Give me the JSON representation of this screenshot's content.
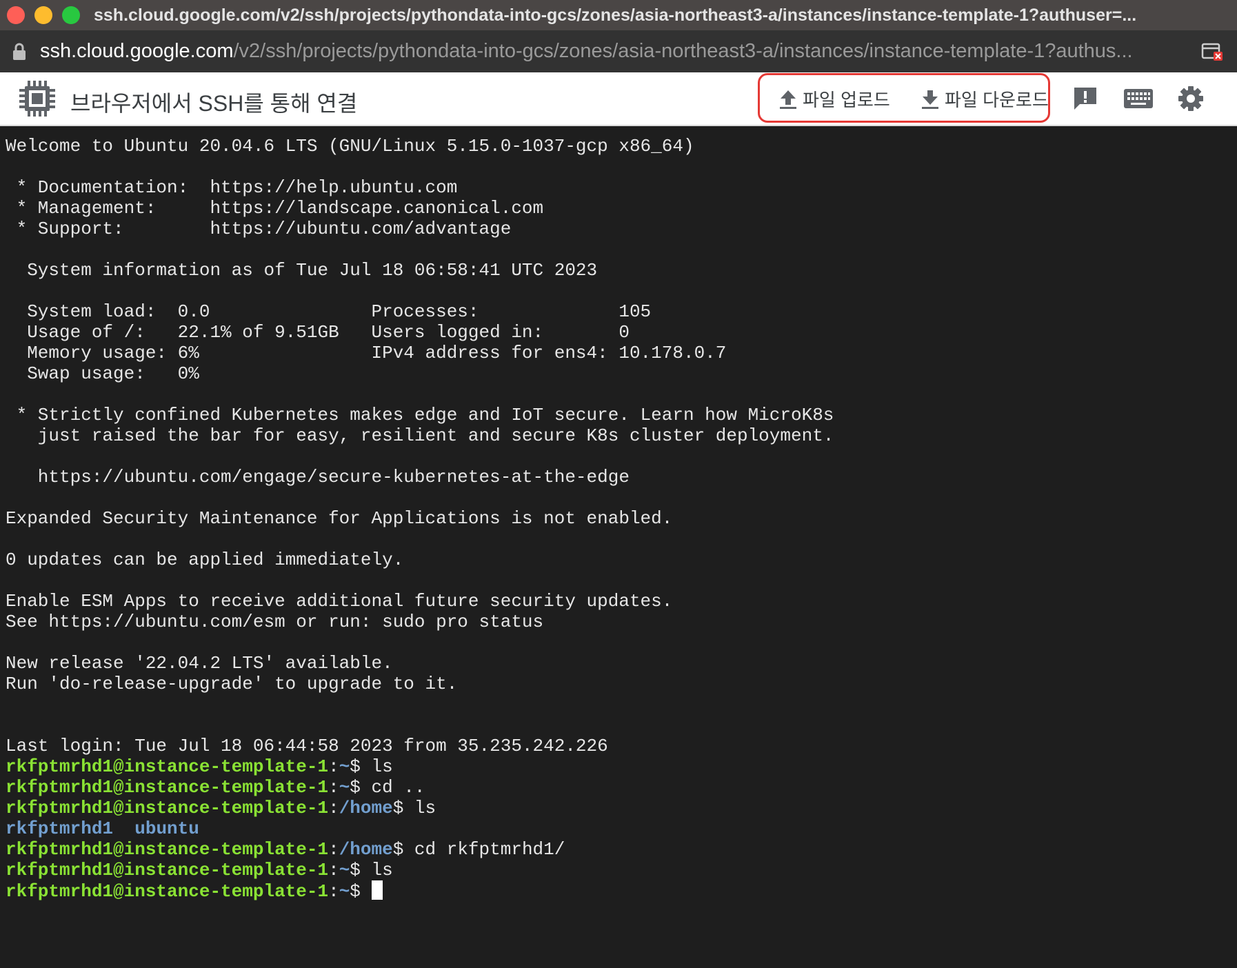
{
  "window": {
    "title": "ssh.cloud.google.com/v2/ssh/projects/pythondata-into-gcs/zones/asia-northeast3-a/instances/instance-template-1?authuser=..."
  },
  "urlbar": {
    "host": "ssh.cloud.google.com",
    "path": "/v2/ssh/projects/pythondata-into-gcs/zones/asia-northeast3-a/instances/instance-template-1?authus..."
  },
  "app": {
    "title": "브라우저에서 SSH를 통해 연결",
    "upload_label": "파일 업로드",
    "download_label": "파일 다운로드",
    "highlight_color": "#e53935"
  },
  "icons": [
    "lock-icon",
    "chip-icon",
    "upload-icon",
    "download-icon",
    "feedback-icon",
    "keyboard-icon",
    "settings-icon"
  ],
  "colors": {
    "terminal_bg": "#1e1e1e",
    "prompt_user": "#8ae234",
    "prompt_path": "#729fcf"
  },
  "terminal": {
    "motd": [
      "Welcome to Ubuntu 20.04.6 LTS (GNU/Linux 5.15.0-1037-gcp x86_64)",
      "",
      " * Documentation:  https://help.ubuntu.com",
      " * Management:     https://landscape.canonical.com",
      " * Support:        https://ubuntu.com/advantage",
      "",
      "  System information as of Tue Jul 18 06:58:41 UTC 2023",
      "",
      "  System load:  0.0               Processes:             105",
      "  Usage of /:   22.1% of 9.51GB   Users logged in:       0",
      "  Memory usage: 6%                IPv4 address for ens4: 10.178.0.7",
      "  Swap usage:   0%",
      "",
      " * Strictly confined Kubernetes makes edge and IoT secure. Learn how MicroK8s",
      "   just raised the bar for easy, resilient and secure K8s cluster deployment.",
      "",
      "   https://ubuntu.com/engage/secure-kubernetes-at-the-edge",
      "",
      "Expanded Security Maintenance for Applications is not enabled.",
      "",
      "0 updates can be applied immediately.",
      "",
      "Enable ESM Apps to receive additional future security updates.",
      "See https://ubuntu.com/esm or run: sudo pro status",
      "",
      "New release '22.04.2 LTS' available.",
      "Run 'do-release-upgrade' to upgrade to it.",
      "",
      "",
      "Last login: Tue Jul 18 06:44:58 2023 from 35.235.242.226"
    ],
    "session": [
      {
        "type": "prompt",
        "user": "rkfptmrhd1@instance-template-1",
        "path": "~",
        "cmd": "ls"
      },
      {
        "type": "prompt",
        "user": "rkfptmrhd1@instance-template-1",
        "path": "~",
        "cmd": "cd .."
      },
      {
        "type": "prompt",
        "user": "rkfptmrhd1@instance-template-1",
        "path": "/home",
        "cmd": "ls"
      },
      {
        "type": "dirs",
        "items": [
          "rkfptmrhd1",
          "ubuntu"
        ]
      },
      {
        "type": "prompt",
        "user": "rkfptmrhd1@instance-template-1",
        "path": "/home",
        "cmd": "cd rkfptmrhd1/"
      },
      {
        "type": "prompt",
        "user": "rkfptmrhd1@instance-template-1",
        "path": "~",
        "cmd": "ls"
      },
      {
        "type": "prompt",
        "user": "rkfptmrhd1@instance-template-1",
        "path": "~",
        "cmd": "",
        "cursor": true
      }
    ]
  }
}
